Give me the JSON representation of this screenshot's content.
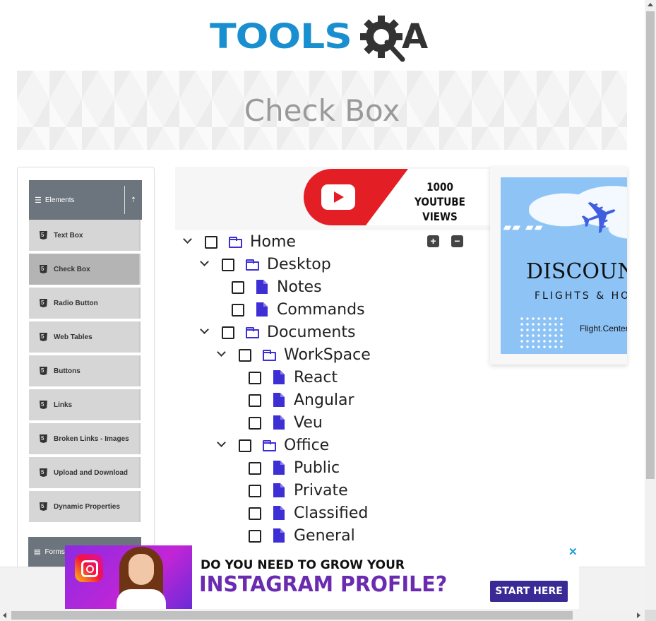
{
  "logo": {
    "tools": "TOOLS",
    "a": "A"
  },
  "banner": {
    "title": "Check Box"
  },
  "sidebar": {
    "group_label": "Elements",
    "items": [
      {
        "label": "Text Box"
      },
      {
        "label": "Check Box",
        "active": true
      },
      {
        "label": "Radio Button"
      },
      {
        "label": "Web Tables"
      },
      {
        "label": "Buttons"
      },
      {
        "label": "Links"
      },
      {
        "label": "Broken Links - Images"
      },
      {
        "label": "Upload and Download"
      },
      {
        "label": "Dynamic Properties"
      }
    ],
    "next_group_label": "Forms"
  },
  "tree": {
    "expand_all": "+",
    "collapse_all": "−",
    "nodes": [
      {
        "label": "Home",
        "type": "folder",
        "expanded": true
      },
      {
        "label": "Desktop",
        "type": "folder",
        "expanded": true
      },
      {
        "label": "Notes",
        "type": "file"
      },
      {
        "label": "Commands",
        "type": "file"
      },
      {
        "label": "Documents",
        "type": "folder",
        "expanded": true
      },
      {
        "label": "WorkSpace",
        "type": "folder",
        "expanded": true
      },
      {
        "label": "React",
        "type": "file"
      },
      {
        "label": "Angular",
        "type": "file"
      },
      {
        "label": "Veu",
        "type": "file"
      },
      {
        "label": "Office",
        "type": "folder",
        "expanded": true
      },
      {
        "label": "Public",
        "type": "file"
      },
      {
        "label": "Private",
        "type": "file"
      },
      {
        "label": "Classified",
        "type": "file"
      },
      {
        "label": "General",
        "type": "file"
      }
    ]
  },
  "ads": {
    "youtube": {
      "line1": "1000",
      "line2": "YOUTUBE VIEWS"
    },
    "flights": {
      "title": "DISCOUNT",
      "subtitle": "FLIGHTS & HOT",
      "brand": "Flight.Center"
    },
    "instagram": {
      "question": "DO YOU NEED TO GROW YOUR",
      "headline": "INSTAGRAM PROFILE?",
      "cta": "START HERE",
      "close": "✕"
    }
  },
  "colors": {
    "accent": "#3e2fd4",
    "sidebar_header": "#6c757d",
    "logo_blue": "#1a8fd0"
  }
}
